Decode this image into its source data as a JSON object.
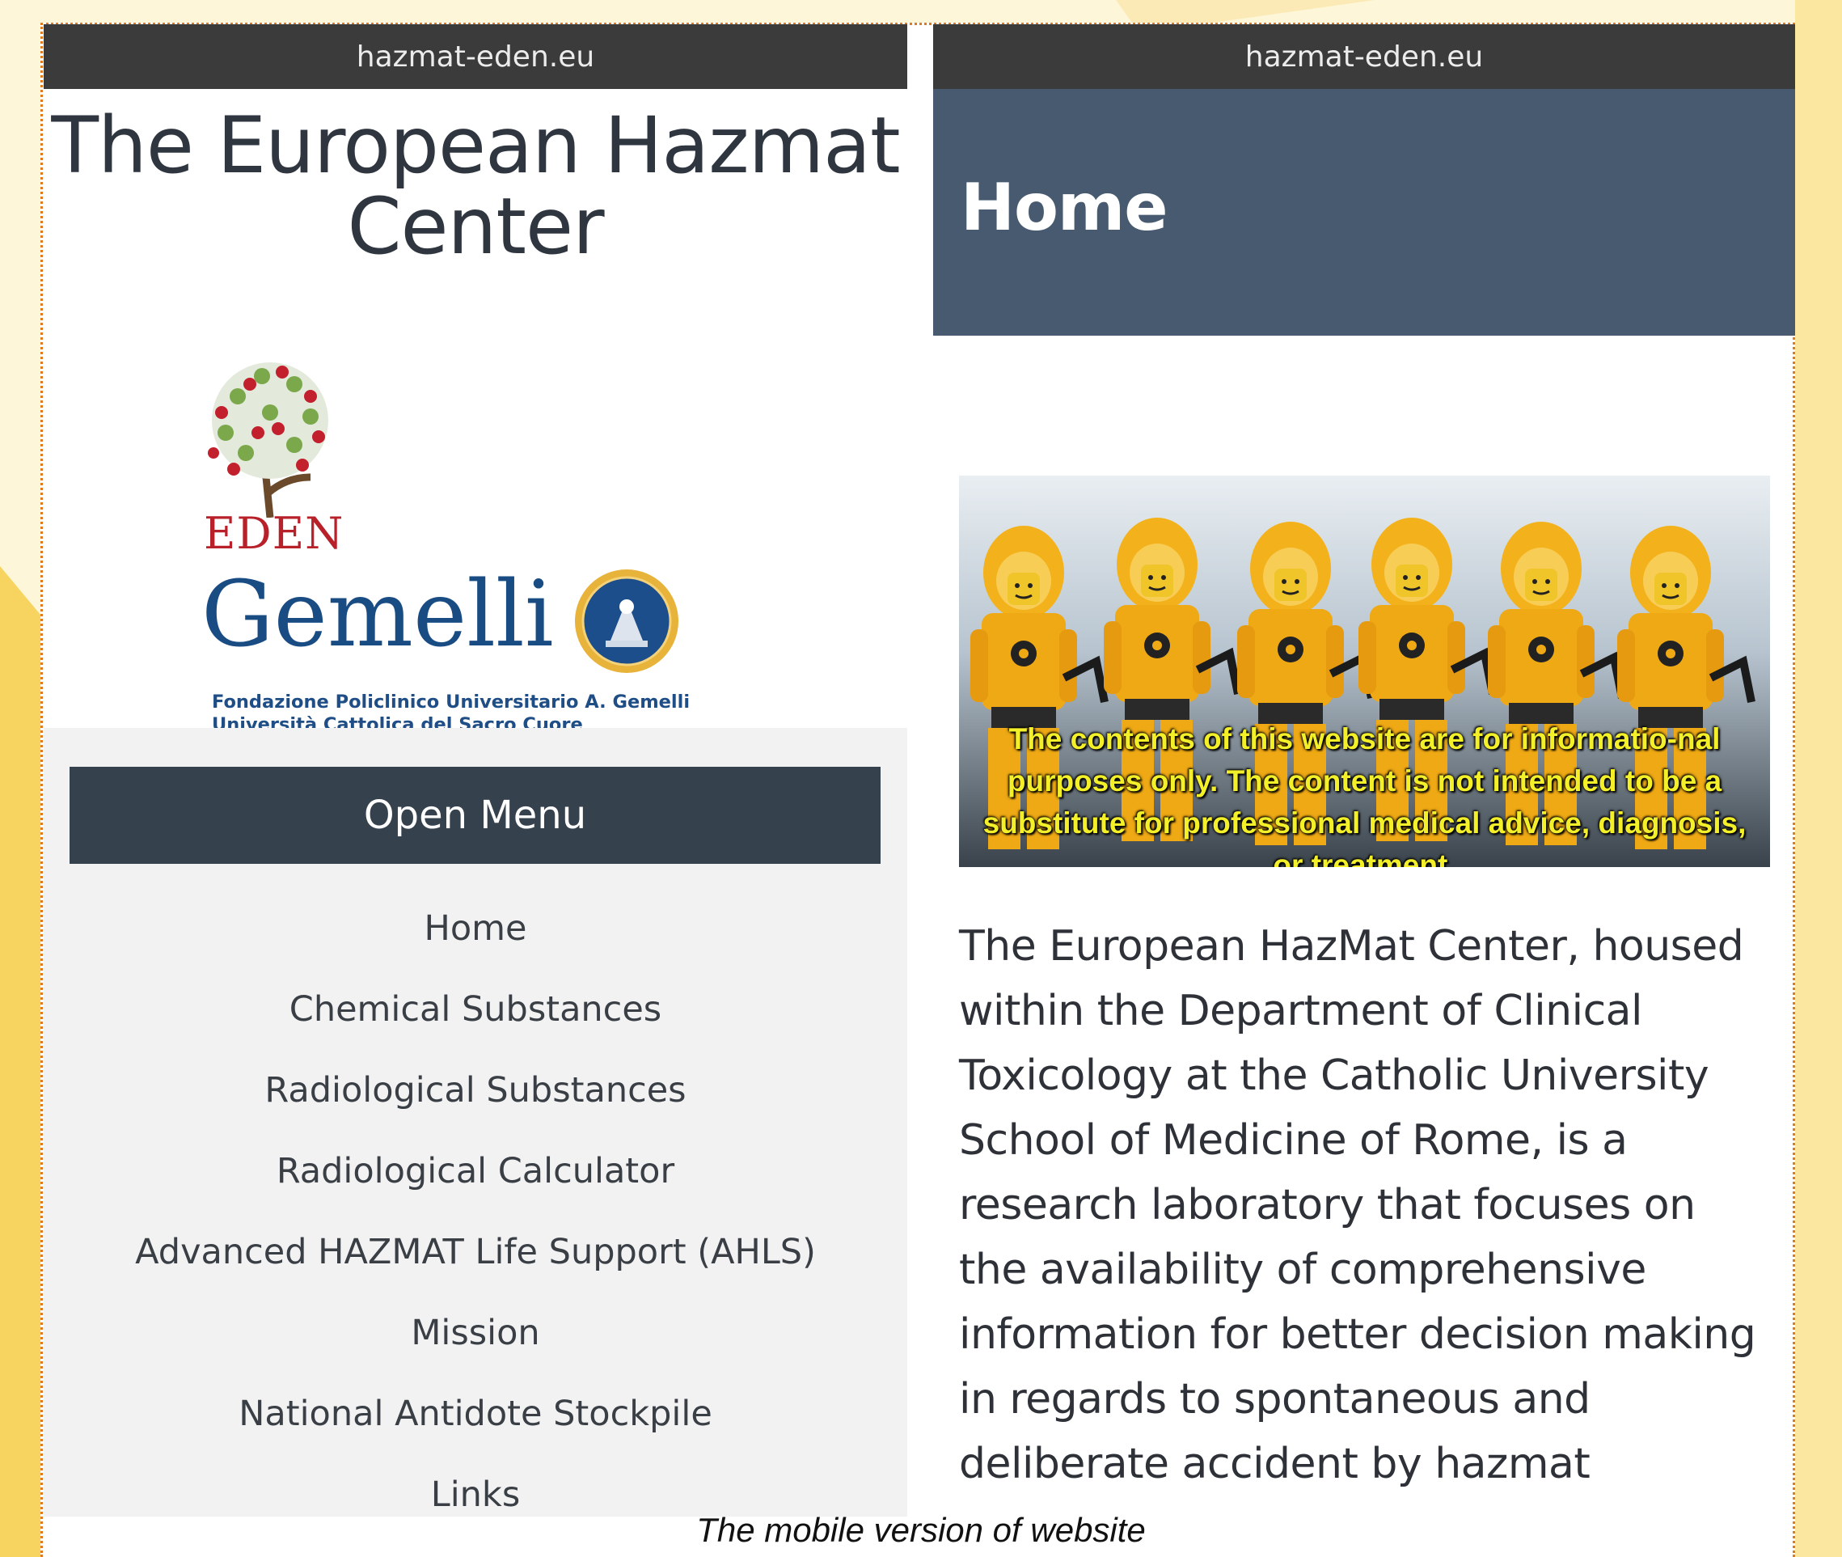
{
  "left_screen": {
    "url": "hazmat-eden.eu",
    "site_title": "The European Hazmat Center",
    "logos": {
      "eden_label": "EDEN",
      "gemelli_label": "Gemelli",
      "fondazione_line1": "Fondazione Policlinico Universitario A. Gemelli",
      "fondazione_line2": "Università Cattolica del Sacro Cuore"
    },
    "open_menu_label": "Open Menu",
    "menu_items": [
      {
        "label": "Home"
      },
      {
        "label": "Chemical Substances"
      },
      {
        "label": "Radiological Substances"
      },
      {
        "label": "Radiological Calculator"
      },
      {
        "label": "Advanced HAZMAT Life Support (AHLS)"
      },
      {
        "label": "Mission"
      },
      {
        "label": "National Antidote Stockpile"
      },
      {
        "label": "Links"
      }
    ]
  },
  "right_screen": {
    "url": "hazmat-eden.eu",
    "page_heading": "Home",
    "hero_caption": "The contents of this website are for informatio-nal purposes only. The content is not intended to be a substitute for professional medical advice, diagnosis, or treatment.",
    "intro_text": "The European HazMat Center, housed within the Department of Clinical Toxicology at the Catholic University School of Medicine of Rome, is a research laboratory that focuses on the availability of comprehensive information for better decision making in regards to spontaneous and deliberate accident by hazmat"
  },
  "figure_caption": "The mobile version of website",
  "colors": {
    "url_bar": "#3b3b3b",
    "menu_button": "#36414e",
    "header_band": "#475a70",
    "frame_border": "#e07a1f",
    "eden_red": "#b8202a",
    "gemelli_blue": "#1a4c84"
  }
}
